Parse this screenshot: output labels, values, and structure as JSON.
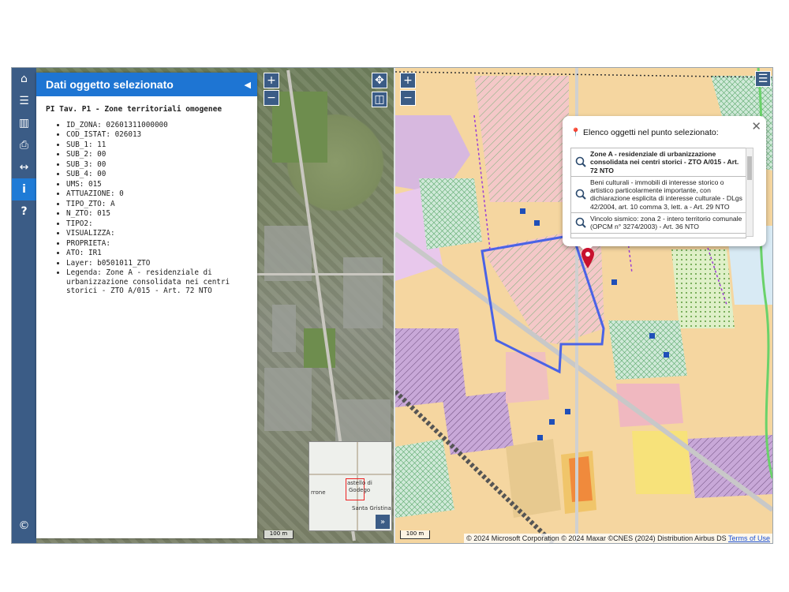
{
  "toolbar": {
    "items": [
      {
        "icon": "home-icon",
        "glyph": "⌂"
      },
      {
        "icon": "menu-icon",
        "glyph": "☰"
      },
      {
        "icon": "map-icon",
        "glyph": "▥"
      },
      {
        "icon": "print-icon",
        "glyph": "⎙"
      },
      {
        "icon": "measure-icon",
        "glyph": "↔"
      },
      {
        "icon": "info-icon",
        "glyph": "i"
      },
      {
        "icon": "help-icon",
        "glyph": "?"
      }
    ],
    "copyright_glyph": "©"
  },
  "panel": {
    "title": "Dati oggetto selezionato",
    "subtitle": "PI Tav. P1 - Zone territoriali omogenee",
    "attributes": [
      "ID_ZONA: 02601311000000",
      "COD_ISTAT: 026013",
      "SUB_1: 11",
      "SUB_2: 00",
      "SUB_3: 00",
      "SUB_4: 00",
      "UMS: 015",
      "ATTUAZIONE: 0",
      "TIPO_ZTO: A",
      "N_ZTO: 015",
      "TIPO2:",
      "VISUALIZZA:",
      "PROPRIETA:",
      "ATO: IR1",
      "Layer: b0501011_ZTO",
      "Legenda: Zone A - residenziale di urbanizzazione consolidata nei centri storici - ZTO A/015 - Art. 72 NTO"
    ]
  },
  "left_map": {
    "zoom_in": "+",
    "zoom_out": "−",
    "pan_glyph": "✥",
    "split_glyph": "◫",
    "scale_label": "100 m",
    "overview_labels": [
      "astello di",
      "Godego",
      "rrone",
      "Santa Gristina"
    ],
    "overview_toggle": "»"
  },
  "right_map": {
    "zoom_in": "+",
    "zoom_out": "−",
    "layers_glyph": "☰",
    "scale_label": "100 m",
    "attribution": "© 2024 Microsoft Corporation © 2024 Maxar ©CNES (2024) Distribution Airbus DS",
    "terms": "Terms of Use"
  },
  "popup": {
    "title": "Elenco oggetti nel punto selezionato:",
    "close": "✕",
    "items": [
      "Zone A - residenziale di urbanizzazione consolidata nei centri storici - ZTO A/015 - Art. 72 NTO",
      "Beni culturali - immobili di interesse storico o artistico particolarmente importante, con dichiarazione esplicita di interesse culturale - DLgs 42/2004, art. 10 comma 3, lett. a - Art. 29 NTO",
      "Vincolo sismico: zona 2 - intero territorio comunale (OPCM n° 3274/2003) - Art. 36 NTO"
    ]
  },
  "colors": {
    "accent": "#1e75d3",
    "toolbar": "#3b5c86",
    "selection_outline": "#4a63e6",
    "marker": "#c8102e"
  }
}
